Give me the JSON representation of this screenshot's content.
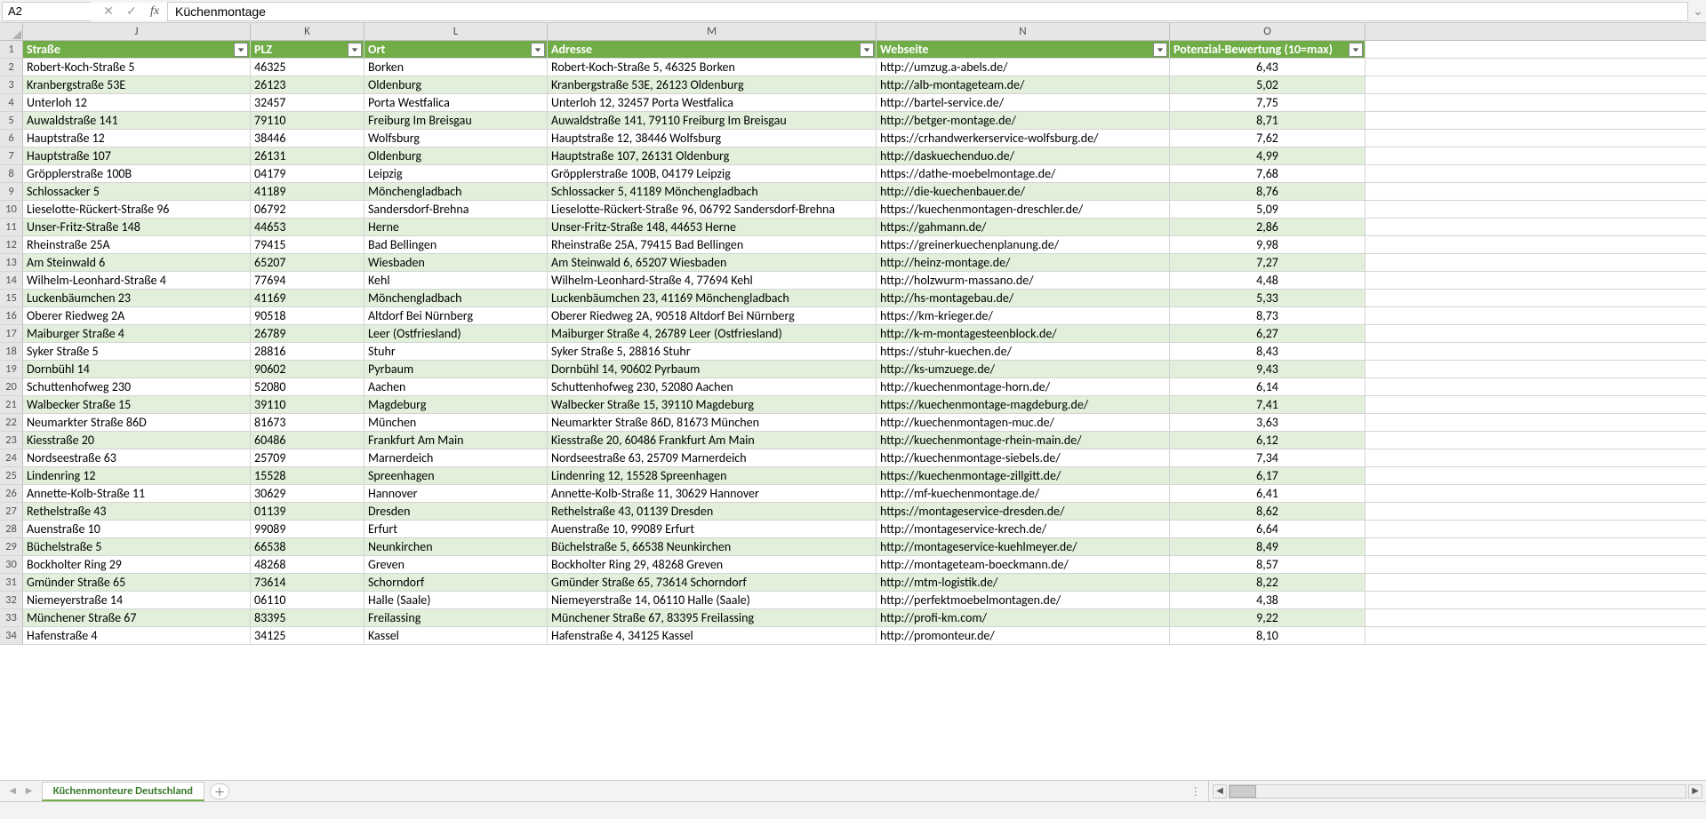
{
  "name_box": "A2",
  "formula_value": "Küchenmontage",
  "sheet_tab": "Küchenmonteure Deutschland",
  "columns": [
    {
      "letter": "J",
      "header": "Straße",
      "class": "c-J"
    },
    {
      "letter": "K",
      "header": "PLZ",
      "class": "c-K"
    },
    {
      "letter": "L",
      "header": "Ort",
      "class": "c-L"
    },
    {
      "letter": "M",
      "header": "Adresse",
      "class": "c-M"
    },
    {
      "letter": "N",
      "header": "Webseite",
      "class": "c-N"
    },
    {
      "letter": "O",
      "header": "Potenzial-Bewertung (10=max)",
      "class": "c-O"
    }
  ],
  "rows": [
    {
      "n": 2,
      "J": "Robert-Koch-Straße 5",
      "K": "46325",
      "L": "Borken",
      "M": "Robert-Koch-Straße 5, 46325 Borken",
      "N": "http://umzug.a-abels.de/",
      "O": "6,43"
    },
    {
      "n": 3,
      "J": "Kranbergstraße 53E",
      "K": "26123",
      "L": "Oldenburg",
      "M": "Kranbergstraße 53E, 26123 Oldenburg",
      "N": "http://alb-montageteam.de/",
      "O": "5,02"
    },
    {
      "n": 4,
      "J": "Unterloh 12",
      "K": "32457",
      "L": "Porta Westfalica",
      "M": "Unterloh 12, 32457 Porta Westfalica",
      "N": "http://bartel-service.de/",
      "O": "7,75"
    },
    {
      "n": 5,
      "J": "Auwaldstraße 141",
      "K": "79110",
      "L": "Freiburg Im Breisgau",
      "M": "Auwaldstraße 141, 79110 Freiburg Im Breisgau",
      "N": "http://betger-montage.de/",
      "O": "8,71"
    },
    {
      "n": 6,
      "J": "Hauptstraße 12",
      "K": "38446",
      "L": "Wolfsburg",
      "M": "Hauptstraße 12, 38446 Wolfsburg",
      "N": "https://crhandwerkerservice-wolfsburg.de/",
      "O": "7,62"
    },
    {
      "n": 7,
      "J": "Hauptstraße 107",
      "K": "26131",
      "L": "Oldenburg",
      "M": "Hauptstraße 107, 26131 Oldenburg",
      "N": "http://daskuechenduo.de/",
      "O": "4,99"
    },
    {
      "n": 8,
      "J": "Gröpplerstraße 100B",
      "K": "04179",
      "L": "Leipzig",
      "M": "Gröpplerstraße 100B, 04179 Leipzig",
      "N": "https://dathe-moebelmontage.de/",
      "O": "7,68"
    },
    {
      "n": 9,
      "J": "Schlossacker 5",
      "K": "41189",
      "L": "Mönchengladbach",
      "M": "Schlossacker 5, 41189 Mönchengladbach",
      "N": "http://die-kuechenbauer.de/",
      "O": "8,76"
    },
    {
      "n": 10,
      "J": "Lieselotte-Rückert-Straße 96",
      "K": "06792",
      "L": "Sandersdorf-Brehna",
      "M": "Lieselotte-Rückert-Straße 96, 06792 Sandersdorf-Brehna",
      "N": "https://kuechenmontagen-dreschler.de/",
      "O": "5,09"
    },
    {
      "n": 11,
      "J": "Unser-Fritz-Straße 148",
      "K": "44653",
      "L": "Herne",
      "M": "Unser-Fritz-Straße 148, 44653 Herne",
      "N": "https://gahmann.de/",
      "O": "2,86"
    },
    {
      "n": 12,
      "J": "Rheinstraße 25A",
      "K": "79415",
      "L": "Bad Bellingen",
      "M": "Rheinstraße 25A, 79415 Bad Bellingen",
      "N": "https://greinerkuechenplanung.de/",
      "O": "9,98"
    },
    {
      "n": 13,
      "J": "Am Steinwald 6",
      "K": "65207",
      "L": "Wiesbaden",
      "M": "Am Steinwald 6, 65207 Wiesbaden",
      "N": "http://heinz-montage.de/",
      "O": "7,27"
    },
    {
      "n": 14,
      "J": "Wilhelm-Leonhard-Straße 4",
      "K": "77694",
      "L": "Kehl",
      "M": "Wilhelm-Leonhard-Straße 4, 77694 Kehl",
      "N": "http://holzwurm-massano.de/",
      "O": "4,48"
    },
    {
      "n": 15,
      "J": "Luckenbäumchen 23",
      "K": "41169",
      "L": "Mönchengladbach",
      "M": "Luckenbäumchen 23, 41169 Mönchengladbach",
      "N": "http://hs-montagebau.de/",
      "O": "5,33"
    },
    {
      "n": 16,
      "J": "Oberer Riedweg 2A",
      "K": "90518",
      "L": "Altdorf Bei Nürnberg",
      "M": "Oberer Riedweg 2A, 90518 Altdorf Bei Nürnberg",
      "N": "https://km-krieger.de/",
      "O": "8,73"
    },
    {
      "n": 17,
      "J": "Maiburger Straße 4",
      "K": "26789",
      "L": "Leer (Ostfriesland)",
      "M": "Maiburger Straße 4, 26789 Leer (Ostfriesland)",
      "N": "http://k-m-montagesteenblock.de/",
      "O": "6,27"
    },
    {
      "n": 18,
      "J": "Syker Straße 5",
      "K": "28816",
      "L": "Stuhr",
      "M": "Syker Straße 5, 28816 Stuhr",
      "N": "https://stuhr-kuechen.de/",
      "O": "8,43"
    },
    {
      "n": 19,
      "J": "Dornbühl 14",
      "K": "90602",
      "L": "Pyrbaum",
      "M": "Dornbühl 14, 90602 Pyrbaum",
      "N": "http://ks-umzuege.de/",
      "O": "9,43"
    },
    {
      "n": 20,
      "J": "Schuttenhofweg 230",
      "K": "52080",
      "L": "Aachen",
      "M": "Schuttenhofweg 230, 52080 Aachen",
      "N": "http://kuechenmontage-horn.de/",
      "O": "6,14"
    },
    {
      "n": 21,
      "J": "Walbecker Straße 15",
      "K": "39110",
      "L": "Magdeburg",
      "M": "Walbecker Straße 15, 39110 Magdeburg",
      "N": "https://kuechenmontage-magdeburg.de/",
      "O": "7,41"
    },
    {
      "n": 22,
      "J": "Neumarkter Straße 86D",
      "K": "81673",
      "L": "München",
      "M": "Neumarkter Straße 86D, 81673 München",
      "N": "http://kuechenmontagen-muc.de/",
      "O": "3,63"
    },
    {
      "n": 23,
      "J": "Kiesstraße 20",
      "K": "60486",
      "L": "Frankfurt Am Main",
      "M": "Kiesstraße 20, 60486 Frankfurt Am Main",
      "N": "http://kuechenmontage-rhein-main.de/",
      "O": "6,12"
    },
    {
      "n": 24,
      "J": "Nordseestraße 63",
      "K": "25709",
      "L": "Marnerdeich",
      "M": "Nordseestraße 63, 25709 Marnerdeich",
      "N": "http://kuechenmontage-siebels.de/",
      "O": "7,34"
    },
    {
      "n": 25,
      "J": "Lindenring 12",
      "K": "15528",
      "L": "Spreenhagen",
      "M": "Lindenring 12, 15528 Spreenhagen",
      "N": "https://kuechenmontage-zillgitt.de/",
      "O": "6,17"
    },
    {
      "n": 26,
      "J": "Annette-Kolb-Straße 11",
      "K": "30629",
      "L": "Hannover",
      "M": "Annette-Kolb-Straße 11, 30629 Hannover",
      "N": "http://mf-kuechenmontage.de/",
      "O": "6,41"
    },
    {
      "n": 27,
      "J": "Rethelstraße 43",
      "K": "01139",
      "L": "Dresden",
      "M": "Rethelstraße 43, 01139 Dresden",
      "N": "https://montageservice-dresden.de/",
      "O": "8,62"
    },
    {
      "n": 28,
      "J": "Auenstraße 10",
      "K": "99089",
      "L": "Erfurt",
      "M": "Auenstraße 10, 99089 Erfurt",
      "N": "http://montageservice-krech.de/",
      "O": "6,64"
    },
    {
      "n": 29,
      "J": "Büchelstraße 5",
      "K": "66538",
      "L": "Neunkirchen",
      "M": "Büchelstraße 5, 66538 Neunkirchen",
      "N": "http://montageservice-kuehlmeyer.de/",
      "O": "8,49"
    },
    {
      "n": 30,
      "J": "Bockholter Ring 29",
      "K": "48268",
      "L": "Greven",
      "M": "Bockholter Ring 29, 48268 Greven",
      "N": "http://montageteam-boeckmann.de/",
      "O": "8,57"
    },
    {
      "n": 31,
      "J": "Gmünder Straße 65",
      "K": "73614",
      "L": "Schorndorf",
      "M": "Gmünder Straße 65, 73614 Schorndorf",
      "N": "http://mtm-logistik.de/",
      "O": "8,22"
    },
    {
      "n": 32,
      "J": "Niemeyerstraße 14",
      "K": "06110",
      "L": "Halle (Saale)",
      "M": "Niemeyerstraße 14, 06110 Halle (Saale)",
      "N": "http://perfektmoebelmontagen.de/",
      "O": "4,38"
    },
    {
      "n": 33,
      "J": "Münchener Straße 67",
      "K": "83395",
      "L": "Freilassing",
      "M": "Münchener Straße 67, 83395 Freilassing",
      "N": "http://profi-km.com/",
      "O": "9,22"
    },
    {
      "n": 34,
      "J": "Hafenstraße 4",
      "K": "34125",
      "L": "Kassel",
      "M": "Hafenstraße 4, 34125 Kassel",
      "N": "http://promonteur.de/",
      "O": "8,10"
    }
  ]
}
